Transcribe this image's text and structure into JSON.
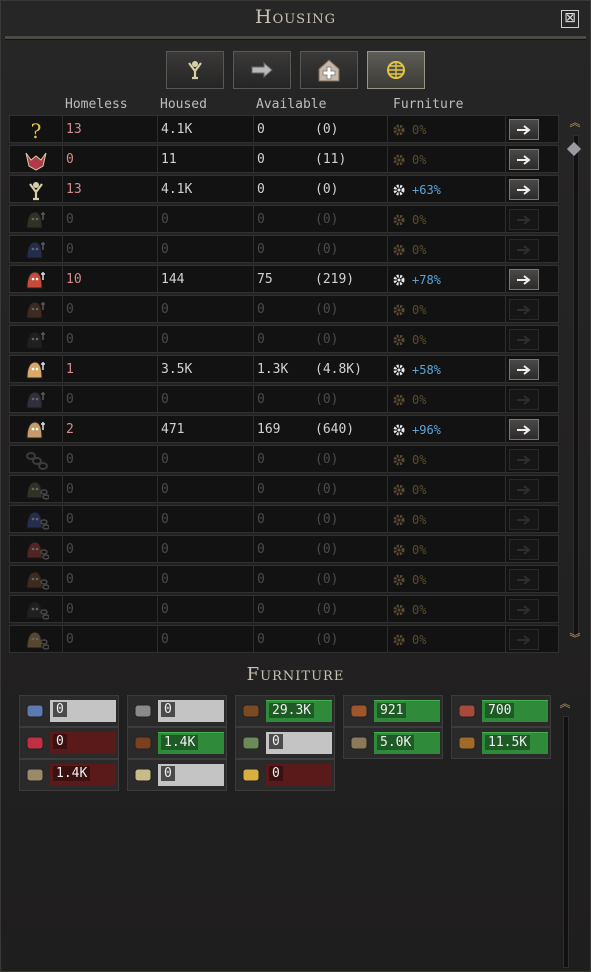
{
  "window": {
    "title": "Housing",
    "close_label": "⊠"
  },
  "tabs": [
    {
      "name": "tab-people",
      "icon": "person-icon",
      "active": false
    },
    {
      "name": "tab-transfer",
      "icon": "hand-arrow-icon",
      "active": false
    },
    {
      "name": "tab-hospital",
      "icon": "medical-cross-icon",
      "active": false
    },
    {
      "name": "tab-world",
      "icon": "globe-icon",
      "active": true
    }
  ],
  "columns": {
    "homeless": "Homeless",
    "housed": "Housed",
    "available": "Available",
    "furniture": "Furniture"
  },
  "rows": [
    {
      "icon": "question-icon",
      "homeless": "13",
      "housed": "4.1K",
      "available": "0",
      "paren": "(0)",
      "furn": "0%",
      "furn_on": false,
      "active": true,
      "btn": true
    },
    {
      "icon": "crest-icon",
      "homeless": "0",
      "housed": "11",
      "available": "0",
      "paren": "(11)",
      "furn": "0%",
      "furn_on": false,
      "active": true,
      "btn": true
    },
    {
      "icon": "person-icon",
      "homeless": "13",
      "housed": "4.1K",
      "available": "0",
      "paren": "(0)",
      "furn": "+63%",
      "furn_on": true,
      "active": true,
      "btn": true
    },
    {
      "icon": "lizard-race-icon",
      "homeless": "0",
      "housed": "0",
      "available": "0",
      "paren": "(0)",
      "furn": "0%",
      "furn_on": false,
      "active": false,
      "btn": false
    },
    {
      "icon": "blue-race-icon",
      "homeless": "0",
      "housed": "0",
      "available": "0",
      "paren": "(0)",
      "furn": "0%",
      "furn_on": false,
      "active": false,
      "btn": false
    },
    {
      "icon": "red-race-icon",
      "homeless": "10",
      "housed": "144",
      "available": "75",
      "paren": "(219)",
      "furn": "+78%",
      "furn_on": true,
      "active": true,
      "btn": true
    },
    {
      "icon": "brown-race-icon",
      "homeless": "0",
      "housed": "0",
      "available": "0",
      "paren": "(0)",
      "furn": "0%",
      "furn_on": false,
      "active": false,
      "btn": false
    },
    {
      "icon": "dark-race-icon",
      "homeless": "0",
      "housed": "0",
      "available": "0",
      "paren": "(0)",
      "furn": "0%",
      "furn_on": false,
      "active": false,
      "btn": false
    },
    {
      "icon": "human-race-icon",
      "homeless": "1",
      "housed": "3.5K",
      "available": "1.3K",
      "paren": "(4.8K)",
      "furn": "+58%",
      "furn_on": true,
      "active": true,
      "btn": true
    },
    {
      "icon": "insect-race-icon",
      "homeless": "0",
      "housed": "0",
      "available": "0",
      "paren": "(0)",
      "furn": "0%",
      "furn_on": false,
      "active": false,
      "btn": false
    },
    {
      "icon": "dwarf-race-icon",
      "homeless": "2",
      "housed": "471",
      "available": "169",
      "paren": "(640)",
      "furn": "+96%",
      "furn_on": true,
      "active": true,
      "btn": true
    },
    {
      "icon": "chain-icon",
      "homeless": "0",
      "housed": "0",
      "available": "0",
      "paren": "(0)",
      "furn": "0%",
      "furn_on": false,
      "active": false,
      "btn": false
    },
    {
      "icon": "chained-lizard-icon",
      "homeless": "0",
      "housed": "0",
      "available": "0",
      "paren": "(0)",
      "furn": "0%",
      "furn_on": false,
      "active": false,
      "btn": false
    },
    {
      "icon": "chained-blue-icon",
      "homeless": "0",
      "housed": "0",
      "available": "0",
      "paren": "(0)",
      "furn": "0%",
      "furn_on": false,
      "active": false,
      "btn": false
    },
    {
      "icon": "chained-red-icon",
      "homeless": "0",
      "housed": "0",
      "available": "0",
      "paren": "(0)",
      "furn": "0%",
      "furn_on": false,
      "active": false,
      "btn": false
    },
    {
      "icon": "chained-brown-icon",
      "homeless": "0",
      "housed": "0",
      "available": "0",
      "paren": "(0)",
      "furn": "0%",
      "furn_on": false,
      "active": false,
      "btn": false
    },
    {
      "icon": "chained-dark-icon",
      "homeless": "0",
      "housed": "0",
      "available": "0",
      "paren": "(0)",
      "furn": "0%",
      "furn_on": false,
      "active": false,
      "btn": false
    },
    {
      "icon": "chained-human-icon",
      "homeless": "0",
      "housed": "0",
      "available": "0",
      "paren": "(0)",
      "furn": "0%",
      "furn_on": false,
      "active": false,
      "btn": false
    }
  ],
  "furniture": {
    "title": "Furniture",
    "items": [
      {
        "icon": "fish-icon",
        "value": "0",
        "state": "gray"
      },
      {
        "icon": "stone-icon",
        "value": "0",
        "state": "gray"
      },
      {
        "icon": "wood-icon",
        "value": "29.3K",
        "state": "green"
      },
      {
        "icon": "leather-icon",
        "value": "921",
        "state": "green"
      },
      {
        "icon": "brick-icon",
        "value": "700",
        "state": "green"
      },
      {
        "icon": "gems-icon",
        "value": "0",
        "state": "red"
      },
      {
        "icon": "fur-icon",
        "value": "1.4K",
        "state": "green"
      },
      {
        "icon": "ore-icon",
        "value": "0",
        "state": "gray"
      },
      {
        "icon": "book-icon",
        "value": "5.0K",
        "state": "green"
      },
      {
        "icon": "furniture-icon",
        "value": "11.5K",
        "state": "green"
      },
      {
        "icon": "pottery-icon",
        "value": "1.4K",
        "state": "red"
      },
      {
        "icon": "cloth-icon",
        "value": "0",
        "state": "gray"
      },
      {
        "icon": "ring-icon",
        "value": "0",
        "state": "red"
      }
    ]
  },
  "colors": {
    "accent_blue": "#5ca4d8",
    "homeless_red": "#d68c8c",
    "bar_green": "#2f8a3a",
    "bar_red": "#5a1a1a"
  }
}
